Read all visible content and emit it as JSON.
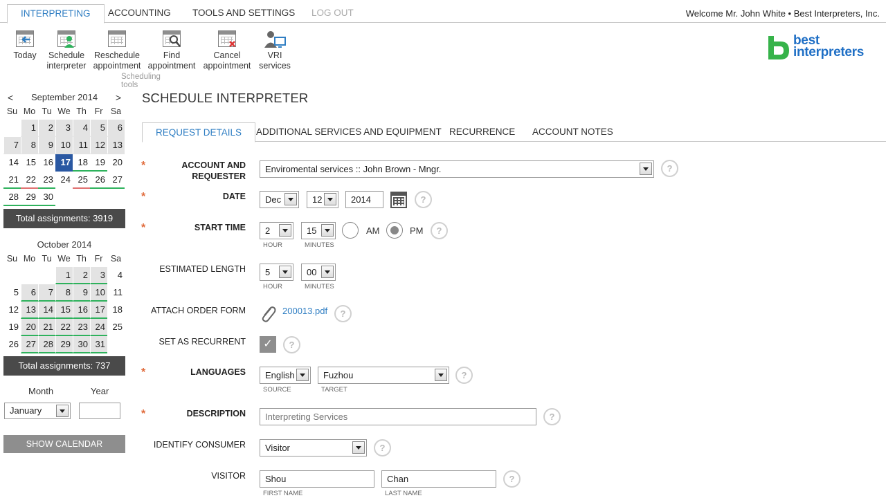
{
  "nav": {
    "tabs": [
      {
        "label": "INTERPRETING"
      },
      {
        "label": "ACCOUNTING"
      },
      {
        "label": "TOOLS AND SETTINGS"
      },
      {
        "label": "LOG OUT"
      }
    ],
    "welcome": "Welcome Mr. John White • Best Interpreters, Inc."
  },
  "ribbon": {
    "buttons": [
      {
        "line1": "Today",
        "line2": "",
        "icon": "calendar-today-icon"
      },
      {
        "line1": "Schedule",
        "line2": "interpreter",
        "icon": "calendar-person-icon"
      },
      {
        "line1": "Reschedule",
        "line2": "appointment",
        "icon": "calendar-icon"
      },
      {
        "line1": "Find",
        "line2": "appointment",
        "icon": "calendar-search-icon"
      },
      {
        "line1": "Cancel",
        "line2": "appointment",
        "icon": "calendar-cancel-icon"
      },
      {
        "line1": "VRI",
        "line2": "services",
        "icon": "video-person-icon"
      }
    ],
    "group_label": "Scheduling tools"
  },
  "logo": {
    "line1": "best",
    "line2": "interpreters"
  },
  "calendar": {
    "prev": "<",
    "next": ">",
    "weekdays": [
      "Su",
      "Mo",
      "Tu",
      "We",
      "Th",
      "Fr",
      "Sa"
    ],
    "months": [
      {
        "title": "September 2014",
        "total": "Total assignments: 3919"
      },
      {
        "title": "October 2014",
        "total": "Total assignments: 737"
      }
    ],
    "month_label": "Month",
    "year_label": "Year",
    "month_value": "January",
    "year_value": "",
    "show_calendar": "SHOW CALENDAR"
  },
  "page": {
    "title": "SCHEDULE INTERPRETER",
    "tabs": [
      {
        "label": "REQUEST DETAILS"
      },
      {
        "label": "ADDITIONAL SERVICES AND EQUIPMENT"
      },
      {
        "label": "RECURRENCE"
      },
      {
        "label": "ACCOUNT NOTES"
      }
    ]
  },
  "form": {
    "required_mark": "*",
    "help": "?",
    "account": {
      "label1": "ACCOUNT AND",
      "label2": "REQUESTER",
      "value": "Enviromental services :: John Brown - Mngr."
    },
    "date": {
      "label": "DATE",
      "month": "Dec",
      "day": "12",
      "year": "2014"
    },
    "start_time": {
      "label": "START TIME",
      "hour": "2",
      "minutes": "15",
      "hour_caption": "HOUR",
      "minutes_caption": "MINUTES",
      "am": "AM",
      "pm": "PM"
    },
    "length": {
      "label": "ESTIMATED LENGTH",
      "hour": "5",
      "minutes": "00",
      "hour_caption": "HOUR",
      "minutes_caption": "MINUTES"
    },
    "attach": {
      "label": "ATTACH ORDER FORM",
      "file": "200013.pdf"
    },
    "recurrent": {
      "label": "SET AS RECURRENT",
      "mark": "✓"
    },
    "languages": {
      "label": "LANGUAGES",
      "source": "English",
      "target": "Fuzhou",
      "source_caption": "SOURCE",
      "target_caption": "TARGET"
    },
    "description": {
      "label": "DESCRIPTION",
      "placeholder": "Interpreting Services"
    },
    "consumer": {
      "label": "IDENTIFY CONSUMER",
      "value": "Visitor"
    },
    "visitor": {
      "label": "VISITOR",
      "first": "Shou",
      "last": "Chan",
      "first_caption": "FIRST NAME",
      "last_caption": "LAST NAME"
    }
  }
}
